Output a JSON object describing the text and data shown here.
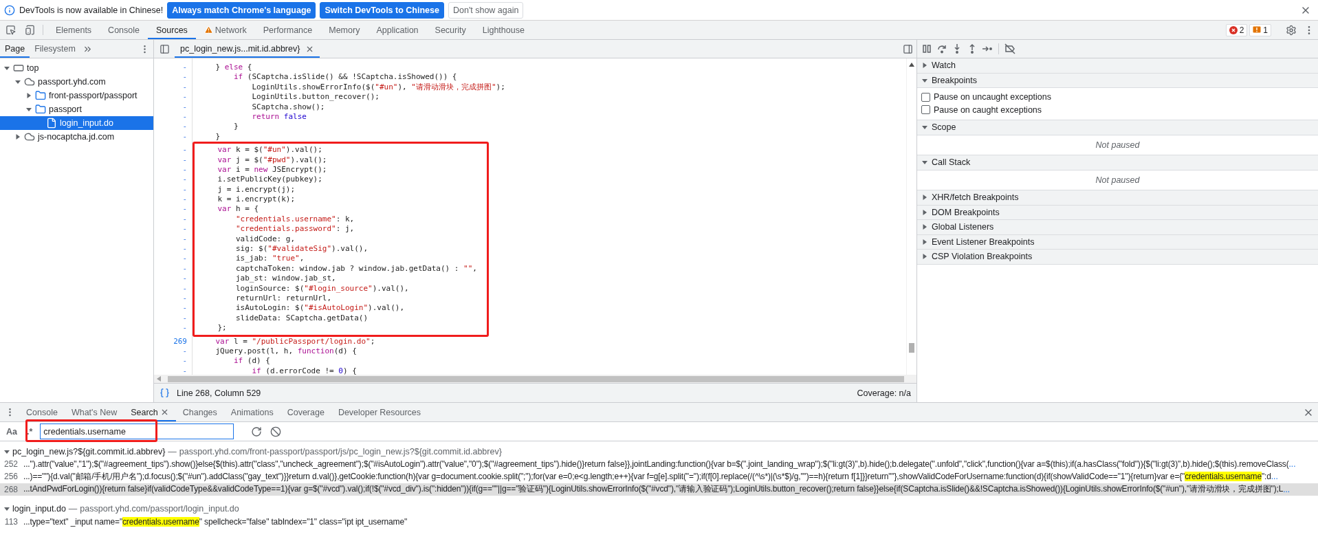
{
  "infobar": {
    "message": "DevTools is now available in Chinese!",
    "buttons": [
      {
        "label": "Always match Chrome's language",
        "kind": "primary"
      },
      {
        "label": "Switch DevTools to Chinese",
        "kind": "primary"
      },
      {
        "label": "Don't show again",
        "kind": "secondary"
      }
    ]
  },
  "main_tabs": [
    {
      "label": "Elements",
      "selected": false,
      "warning": false
    },
    {
      "label": "Console",
      "selected": false,
      "warning": false
    },
    {
      "label": "Sources",
      "selected": true,
      "warning": false
    },
    {
      "label": "Network",
      "selected": false,
      "warning": true
    },
    {
      "label": "Performance",
      "selected": false,
      "warning": false
    },
    {
      "label": "Memory",
      "selected": false,
      "warning": false
    },
    {
      "label": "Application",
      "selected": false,
      "warning": false
    },
    {
      "label": "Security",
      "selected": false,
      "warning": false
    },
    {
      "label": "Lighthouse",
      "selected": false,
      "warning": false
    }
  ],
  "issues": {
    "errors": "2",
    "warnings": "1"
  },
  "navigator": {
    "tabs": [
      {
        "label": "Page",
        "selected": true
      },
      {
        "label": "Filesystem",
        "selected": false
      }
    ],
    "tree": [
      {
        "label": "top",
        "kind": "frame",
        "expanded": true,
        "selected": false,
        "children": [
          {
            "label": "passport.yhd.com",
            "kind": "domain",
            "expanded": true,
            "selected": false,
            "children": [
              {
                "label": "front-passport/passport",
                "kind": "folder",
                "expanded": false,
                "selected": false
              },
              {
                "label": "passport",
                "kind": "folder",
                "expanded": true,
                "selected": false,
                "children": [
                  {
                    "label": "login_input.do",
                    "kind": "file",
                    "selected": true
                  }
                ]
              }
            ]
          },
          {
            "label": "js-nocaptcha.jd.com",
            "kind": "domain",
            "expanded": false,
            "selected": false
          }
        ]
      }
    ]
  },
  "editor": {
    "tabs": [
      {
        "label": "pc_login_new.js...mit.id.abbrev}",
        "selected": true
      }
    ],
    "lines": [
      {
        "no": "-",
        "marked": false,
        "segs": [
          {
            "kind": "plain",
            "text": "    } "
          },
          {
            "kind": "keyword",
            "text": "else"
          },
          {
            "kind": "plain",
            "text": " {"
          }
        ]
      },
      {
        "no": "-",
        "marked": false,
        "segs": [
          {
            "kind": "keyword",
            "text": "        if"
          },
          {
            "kind": "plain",
            "text": " (SCaptcha.isSlide() && !SCaptcha.isShowed()) {"
          }
        ]
      },
      {
        "no": "-",
        "marked": false,
        "segs": [
          {
            "kind": "plain",
            "text": "            LoginUtils.showErrorInfo($("
          },
          {
            "kind": "string",
            "text": "\"#un\""
          },
          {
            "kind": "plain",
            "text": "), "
          },
          {
            "kind": "string",
            "text": "\"请滑动滑块，完成拼图\""
          },
          {
            "kind": "plain",
            "text": ");"
          }
        ]
      },
      {
        "no": "-",
        "marked": false,
        "segs": [
          {
            "kind": "plain",
            "text": "            LoginUtils.button_recover();"
          }
        ]
      },
      {
        "no": "-",
        "marked": false,
        "segs": [
          {
            "kind": "plain",
            "text": "            SCaptcha.show();"
          }
        ]
      },
      {
        "no": "-",
        "marked": false,
        "segs": [
          {
            "kind": "keyword",
            "text": "            return"
          },
          {
            "kind": "literal",
            "text": " false"
          }
        ]
      },
      {
        "no": "-",
        "marked": false,
        "segs": [
          {
            "kind": "plain",
            "text": "        }"
          }
        ]
      },
      {
        "no": "-",
        "marked": false,
        "segs": [
          {
            "kind": "plain",
            "text": "    }"
          }
        ]
      },
      {
        "no": "-",
        "marked": true,
        "segs": [
          {
            "kind": "keyword",
            "text": "    var"
          },
          {
            "kind": "plain",
            "text": " k = $("
          },
          {
            "kind": "string",
            "text": "\"#un\""
          },
          {
            "kind": "plain",
            "text": ").val();"
          }
        ]
      },
      {
        "no": "-",
        "marked": true,
        "segs": [
          {
            "kind": "keyword",
            "text": "    var"
          },
          {
            "kind": "plain",
            "text": " j = $("
          },
          {
            "kind": "string",
            "text": "\"#pwd\""
          },
          {
            "kind": "plain",
            "text": ").val();"
          }
        ]
      },
      {
        "no": "-",
        "marked": true,
        "segs": [
          {
            "kind": "keyword",
            "text": "    var"
          },
          {
            "kind": "plain",
            "text": " i = "
          },
          {
            "kind": "keyword",
            "text": "new"
          },
          {
            "kind": "plain",
            "text": " JSEncrypt();"
          }
        ]
      },
      {
        "no": "-",
        "marked": true,
        "segs": [
          {
            "kind": "plain",
            "text": "    i.setPublicKey(pubkey);"
          }
        ]
      },
      {
        "no": "-",
        "marked": true,
        "segs": [
          {
            "kind": "plain",
            "text": "    j = i.encrypt(j);"
          }
        ]
      },
      {
        "no": "-",
        "marked": true,
        "segs": [
          {
            "kind": "plain",
            "text": "    k = i.encrypt(k);"
          }
        ]
      },
      {
        "no": "-",
        "marked": true,
        "segs": [
          {
            "kind": "keyword",
            "text": "    var"
          },
          {
            "kind": "plain",
            "text": " h = {"
          }
        ]
      },
      {
        "no": "-",
        "marked": true,
        "segs": [
          {
            "kind": "string",
            "text": "        \"credentials.username\""
          },
          {
            "kind": "plain",
            "text": ": k,"
          }
        ]
      },
      {
        "no": "-",
        "marked": true,
        "segs": [
          {
            "kind": "string",
            "text": "        \"credentials.password\""
          },
          {
            "kind": "plain",
            "text": ": j,"
          }
        ]
      },
      {
        "no": "-",
        "marked": true,
        "segs": [
          {
            "kind": "plain",
            "text": "        validCode: g,"
          }
        ]
      },
      {
        "no": "-",
        "marked": true,
        "segs": [
          {
            "kind": "plain",
            "text": "        sig: $("
          },
          {
            "kind": "string",
            "text": "\"#validateSig\""
          },
          {
            "kind": "plain",
            "text": ").val(),"
          }
        ]
      },
      {
        "no": "-",
        "marked": true,
        "segs": [
          {
            "kind": "plain",
            "text": "        is_jab: "
          },
          {
            "kind": "string",
            "text": "\"true\""
          },
          {
            "kind": "plain",
            "text": ","
          }
        ]
      },
      {
        "no": "-",
        "marked": true,
        "segs": [
          {
            "kind": "plain",
            "text": "        captchaToken: window.jab ? window.jab.getData() : "
          },
          {
            "kind": "string",
            "text": "\"\""
          },
          {
            "kind": "plain",
            "text": ","
          }
        ]
      },
      {
        "no": "-",
        "marked": true,
        "segs": [
          {
            "kind": "plain",
            "text": "        jab_st: window.jab_st,"
          }
        ]
      },
      {
        "no": "-",
        "marked": true,
        "segs": [
          {
            "kind": "plain",
            "text": "        loginSource: $("
          },
          {
            "kind": "string",
            "text": "\"#login_source\""
          },
          {
            "kind": "plain",
            "text": ").val(),"
          }
        ]
      },
      {
        "no": "-",
        "marked": true,
        "segs": [
          {
            "kind": "plain",
            "text": "        returnUrl: returnUrl,"
          }
        ]
      },
      {
        "no": "-",
        "marked": true,
        "segs": [
          {
            "kind": "plain",
            "text": "        isAutoLogin: $("
          },
          {
            "kind": "string",
            "text": "\"#isAutoLogin\""
          },
          {
            "kind": "plain",
            "text": ").val(),"
          }
        ]
      },
      {
        "no": "-",
        "marked": true,
        "segs": [
          {
            "kind": "plain",
            "text": "        slideData: SCaptcha.getData()"
          }
        ]
      },
      {
        "no": "-",
        "marked": true,
        "segs": [
          {
            "kind": "plain",
            "text": "    };"
          }
        ]
      },
      {
        "no": "269",
        "marked": false,
        "segs": [
          {
            "kind": "keyword",
            "text": "    var"
          },
          {
            "kind": "plain",
            "text": " l = "
          },
          {
            "kind": "string",
            "text": "\"/publicPassport/login.do\""
          },
          {
            "kind": "plain",
            "text": ";"
          }
        ]
      },
      {
        "no": "-",
        "marked": false,
        "segs": [
          {
            "kind": "plain",
            "text": "    jQuery.post(l, h, "
          },
          {
            "kind": "keyword",
            "text": "function"
          },
          {
            "kind": "plain",
            "text": "(d) {"
          }
        ]
      },
      {
        "no": "-",
        "marked": false,
        "segs": [
          {
            "kind": "keyword",
            "text": "        if"
          },
          {
            "kind": "plain",
            "text": " (d) {"
          }
        ]
      },
      {
        "no": "-",
        "marked": false,
        "segs": [
          {
            "kind": "keyword",
            "text": "            if"
          },
          {
            "kind": "plain",
            "text": " (d.errorCode != "
          },
          {
            "kind": "literal",
            "text": "0"
          },
          {
            "kind": "plain",
            "text": ") {"
          }
        ]
      }
    ],
    "status": {
      "position": "Line 268, Column 529",
      "coverage": "Coverage: n/a"
    }
  },
  "debugger": {
    "sections": [
      {
        "title": "Watch",
        "kind": "empty",
        "expanded": false
      },
      {
        "title": "Breakpoints",
        "kind": "checks",
        "expanded": true,
        "checkboxes": [
          {
            "label": "Pause on uncaught exceptions",
            "checked": false
          },
          {
            "label": "Pause on caught exceptions",
            "checked": false
          }
        ]
      },
      {
        "title": "Scope",
        "kind": "message",
        "expanded": true,
        "message": "Not paused"
      },
      {
        "title": "Call Stack",
        "kind": "message",
        "expanded": true,
        "message": "Not paused"
      },
      {
        "title": "XHR/fetch Breakpoints",
        "kind": "empty",
        "expanded": false
      },
      {
        "title": "DOM Breakpoints",
        "kind": "empty",
        "expanded": false
      },
      {
        "title": "Global Listeners",
        "kind": "empty",
        "expanded": false
      },
      {
        "title": "Event Listener Breakpoints",
        "kind": "empty",
        "expanded": false
      },
      {
        "title": "CSP Violation Breakpoints",
        "kind": "empty",
        "expanded": false
      }
    ]
  },
  "drawer": {
    "tabs": [
      {
        "label": "Console",
        "selected": false,
        "closable": false
      },
      {
        "label": "What's New",
        "selected": false,
        "closable": false
      },
      {
        "label": "Search",
        "selected": true,
        "closable": true
      },
      {
        "label": "Changes",
        "selected": false,
        "closable": false
      },
      {
        "label": "Animations",
        "selected": false,
        "closable": false
      },
      {
        "label": "Coverage",
        "selected": false,
        "closable": false
      },
      {
        "label": "Developer Resources",
        "selected": false,
        "closable": false
      }
    ],
    "search": {
      "case_toggle": {
        "label": "Aa",
        "on": false
      },
      "regex_toggle": {
        "label": ".*",
        "on": false
      },
      "value": "credentials.username",
      "annotated": true
    },
    "results": [
      {
        "file": "pc_login_new.js?${git.commit.id.abbrev}",
        "separator": "—",
        "path": "passport.yhd.com/front-passport/passport/js/pc_login_new.js?${git.commit.id.abbrev}",
        "expanded": true,
        "matches": [
          {
            "line": "252",
            "selected": false,
            "more": "...",
            "parts": [
              {
                "t": "...\").attr(\"value\",\"1\");$(\"#agreement_tips\").show()}else{$(this).attr(\"class\",\"uncheck_agreement\");$(\"#isAutoLogin\").attr(\"value\",\"0\");$(\"#agreement_tips\").hide()}return false}},jointLanding:function(){var b=$(\".joint_landing_wrap\");$(\"li:gt(3)\",b).hide();b.delegate(\".unfold\",\"click\",function(){var a=$(this);if(a.hasClass(\"fold\")){$(\"li:gt(3)\",b).hide();$(this).removeClass(",
                "match": false
              }
            ]
          },
          {
            "line": "256",
            "selected": false,
            "more": "...",
            "parts": [
              {
                "t": "...)==\"\"){d.val(\"邮箱/手机/用户名\");d.focus();$(\"#un\").addClass(\"gay_text\")}}return d.val()},getCookie:function(h){var g=document.cookie.split(\";\");for(var e=0;e<g.length;e++){var f=g[e].split(\"=\");if(f[0].replace(/(^\\s*)|(\\s*$)/g,\"\")==h){return f[1]}}return\"\"},showValidCodeForUsername:function(d){if(showValidCode==\"1\"){return}var e={\"",
                "match": false
              },
              {
                "t": "credentials.username",
                "match": true
              },
              {
                "t": "\":d",
                "match": false
              }
            ]
          },
          {
            "line": "268",
            "selected": true,
            "more": "...",
            "parts": [
              {
                "t": "...tAndPwdForLogin()){return false}if(validCodeType&&validCodeType==1){var g=$(\"#vcd\").val();if(!$(\"#vcd_div\").is(\":hidden\")){if(g==\"\"||g==\"验证码\"){LoginUtils.showErrorInfo($(\"#vcd\"),\"请输入验证码\");LoginUtils.button_recover();return false}}else{if(SCaptcha.isSlide()&&!SCaptcha.isShowed()){LoginUtils.showErrorInfo($(\"#un\"),\"请滑动滑块，完成拼图\");L",
                "match": false
              }
            ]
          }
        ]
      },
      {
        "file": "login_input.do",
        "separator": "—",
        "path": "passport.yhd.com/passport/login_input.do",
        "expanded": true,
        "matches": [
          {
            "line": "113",
            "selected": false,
            "parts": [
              {
                "t": "...type=\"text\" _input name=\"",
                "match": false
              },
              {
                "t": "credentials.username",
                "match": true
              },
              {
                "t": "\" spellcheck=\"false\" tabIndex=\"1\" class=\"ipt ipt_username\"",
                "match": false
              }
            ]
          }
        ]
      }
    ]
  }
}
